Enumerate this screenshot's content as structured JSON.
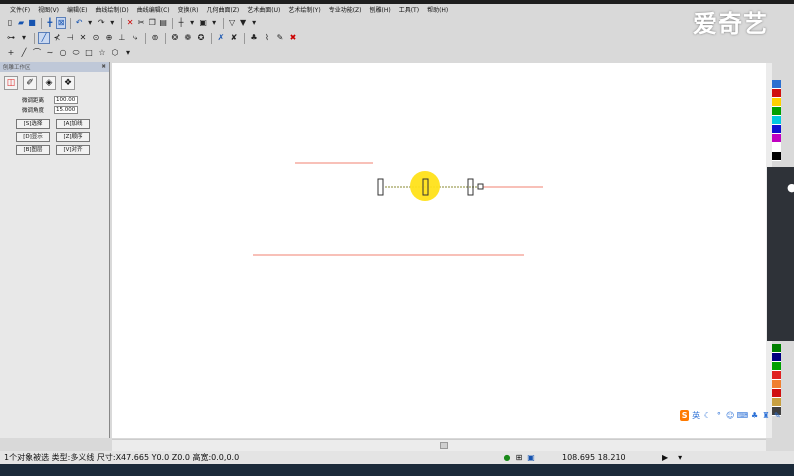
{
  "watermark": "爱奇艺",
  "menu": [
    "文件(F)",
    "视图(V)",
    "编辑(E)",
    "曲线绘制(D)",
    "曲线编辑(C)",
    "变换(R)",
    "几何曲面(Z)",
    "艺术曲面(U)",
    "艺术绘制(Y)",
    "专业功能(Z)",
    "刨雕(H)",
    "工具(T)",
    "帮助(H)"
  ],
  "left_panel": {
    "title": "刨雕工作区",
    "fields": [
      {
        "label": "微调距离",
        "value": "100.00"
      },
      {
        "label": "微调角度",
        "value": "15.000"
      }
    ],
    "buttons": [
      [
        "[S]选择",
        "[A]加线"
      ],
      [
        "[D]显示",
        "[Z]顺序"
      ],
      [
        "[B]图层",
        "[V]对齐"
      ]
    ]
  },
  "status": {
    "text": "1个对象被选 类型:多义线 尺寸:X47.665 Y0.0 Z0.0 高宽:0.0,0.0",
    "coords": "108.695 18.210"
  },
  "ime": {
    "label": "英"
  },
  "palette": [
    "#2b6fd0",
    "#d01010",
    "#ffd000",
    "#00a000",
    "#00c8e0",
    "#1010d0",
    "#c000c0",
    "#ffffff",
    "#000000"
  ],
  "palette_bottom": [
    "#008000",
    "#000080",
    "#00a000",
    "#e02020",
    "#f08030",
    "#d01010",
    "#c8a040",
    "#404040"
  ],
  "colors": {
    "line": "#f08070",
    "canvas_bg": "#ffffff",
    "highlight": "#ffd700"
  }
}
